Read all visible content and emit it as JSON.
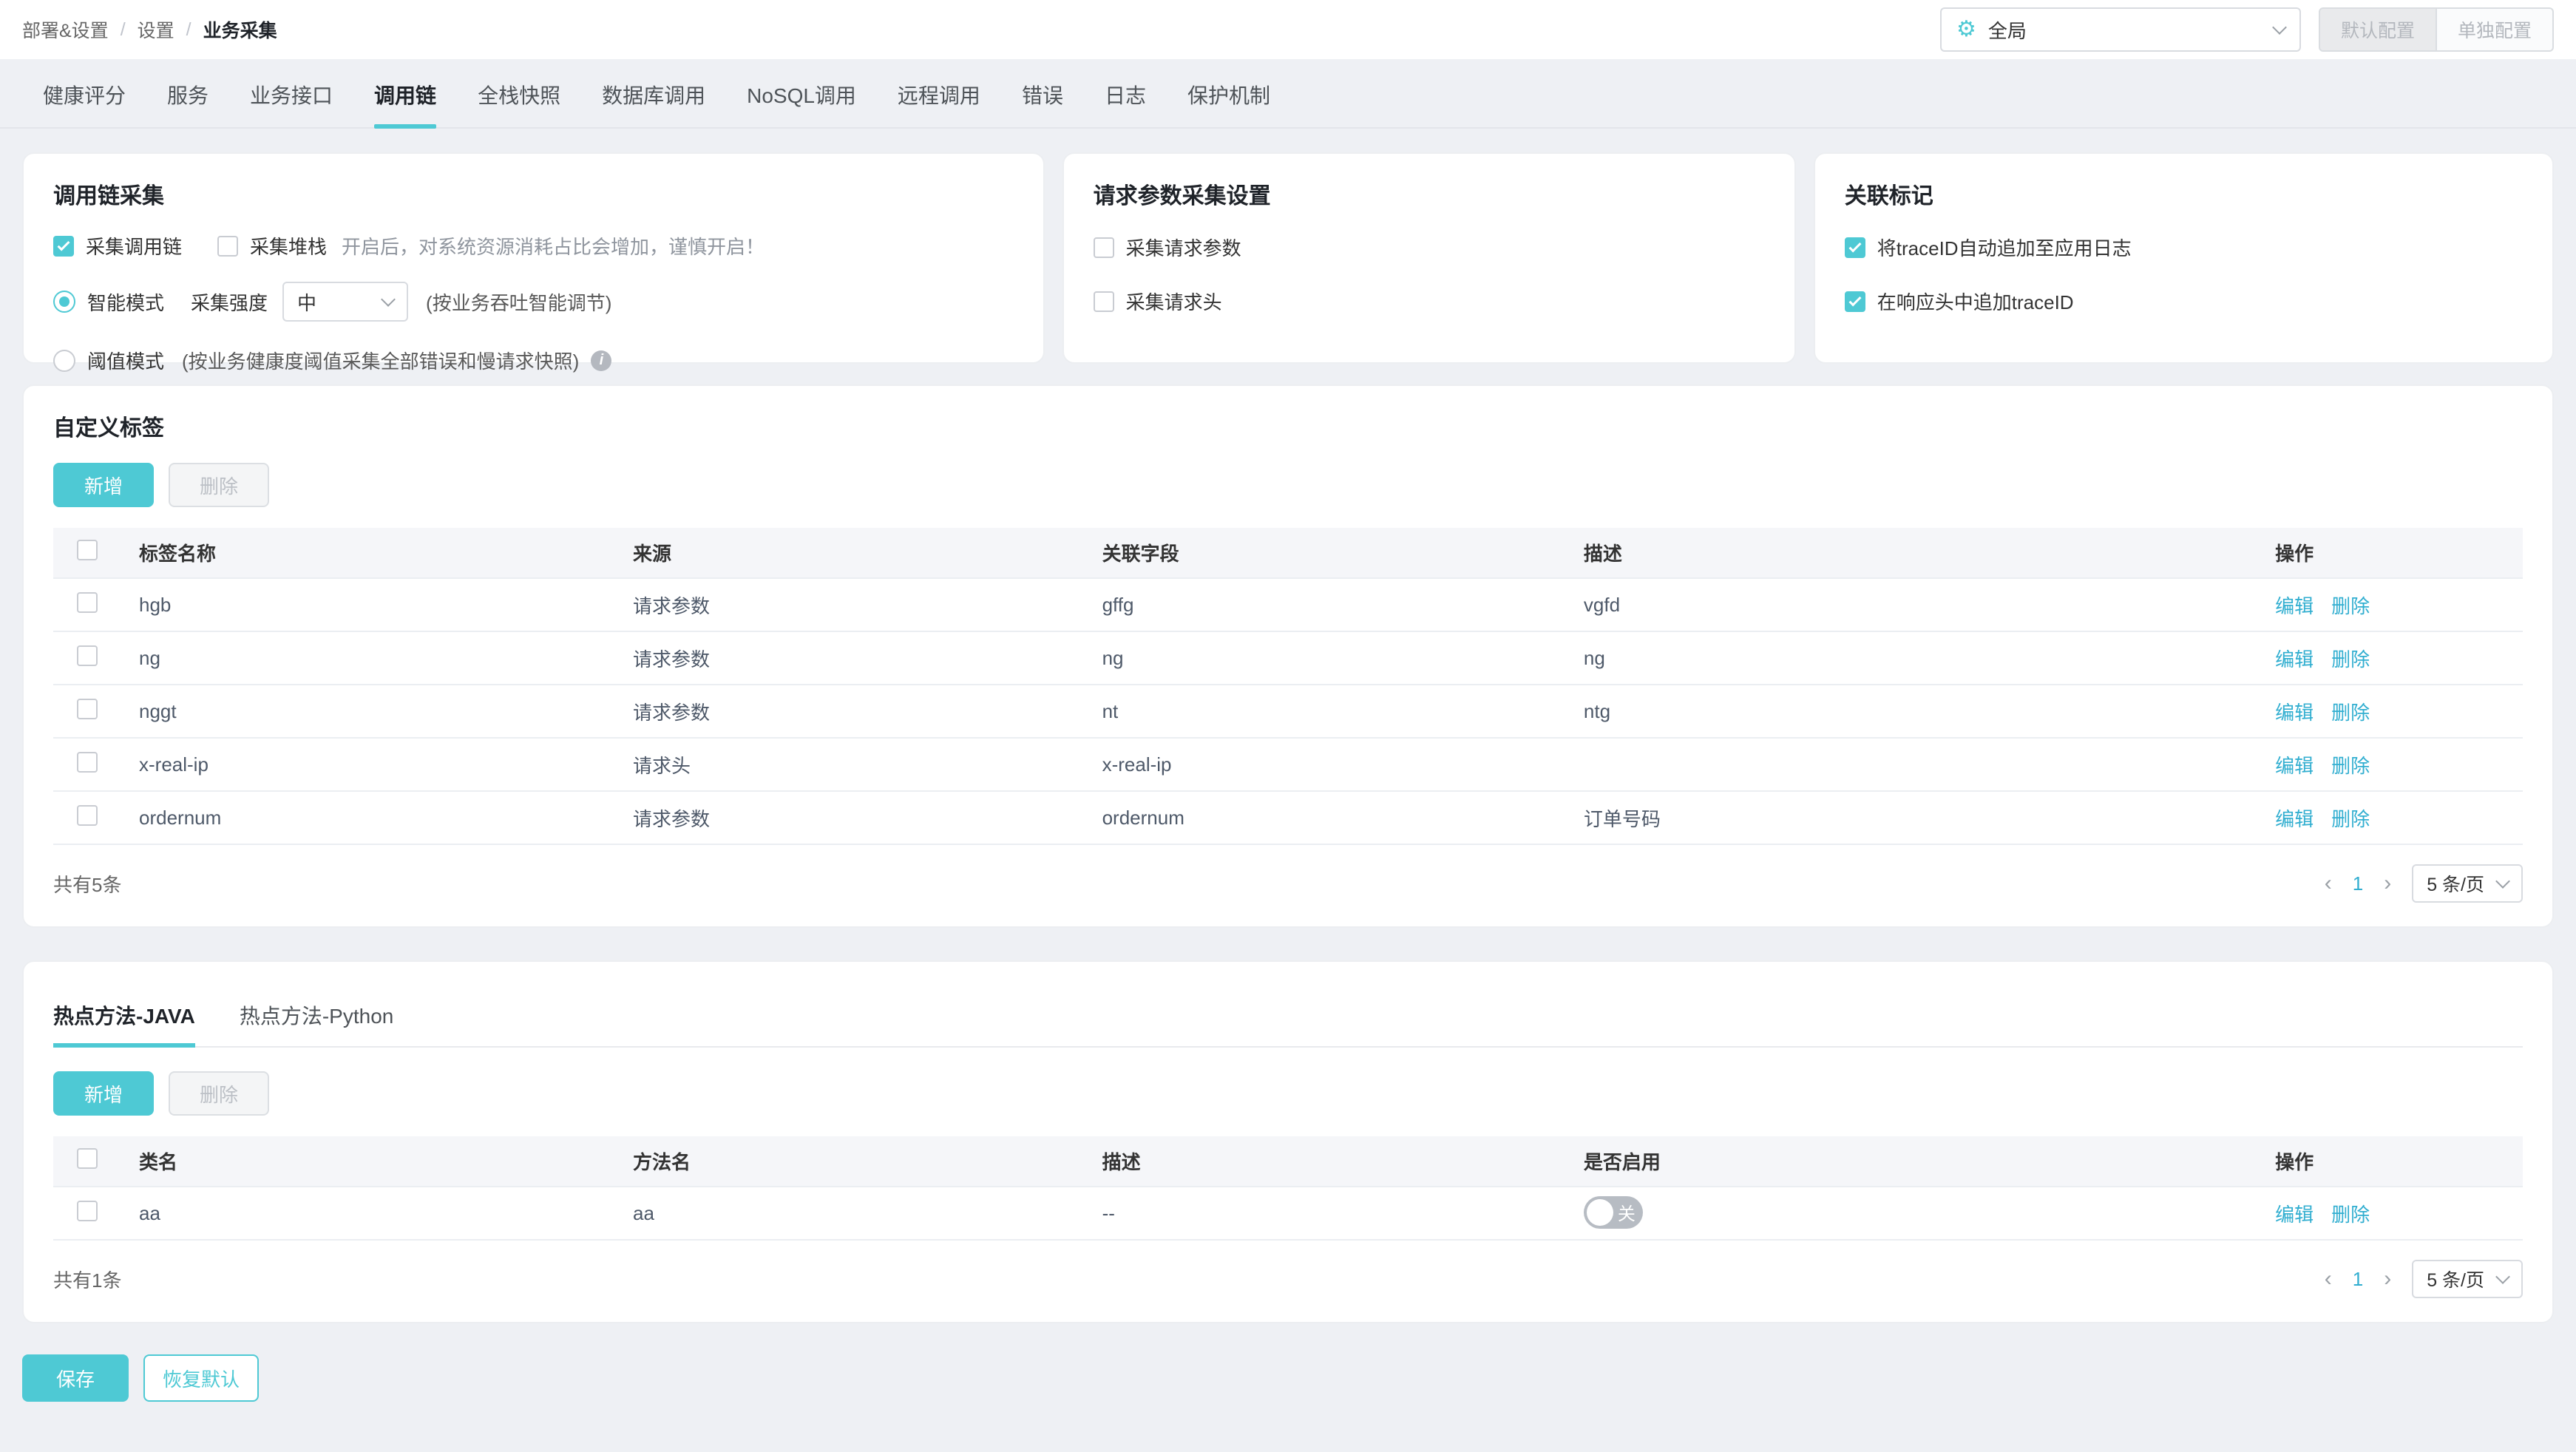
{
  "colors": {
    "accent": "#4ec9d4",
    "link": "#31aed0"
  },
  "icons": {
    "gear": "⚙",
    "info": "i",
    "prev": "‹",
    "next": "›"
  },
  "breadcrumb": {
    "items": [
      "部署&设置",
      "设置",
      "业务采集"
    ]
  },
  "header": {
    "scope_value": "全局",
    "default_config_btn": "默认配置",
    "separate_config_btn": "单独配置"
  },
  "tabs": [
    {
      "label": "健康评分",
      "active": false
    },
    {
      "label": "服务",
      "active": false
    },
    {
      "label": "业务接口",
      "active": false
    },
    {
      "label": "调用链",
      "active": true
    },
    {
      "label": "全栈快照",
      "active": false
    },
    {
      "label": "数据库调用",
      "active": false
    },
    {
      "label": "NoSQL调用",
      "active": false
    },
    {
      "label": "远程调用",
      "active": false
    },
    {
      "label": "错误",
      "active": false
    },
    {
      "label": "日志",
      "active": false
    },
    {
      "label": "保护机制",
      "active": false
    }
  ],
  "trace_card": {
    "title": "调用链采集",
    "cb_trace": {
      "label": "采集调用链",
      "checked": true
    },
    "cb_stack": {
      "label": "采集堆栈",
      "checked": false
    },
    "stack_hint": "开启后，对系统资源消耗占比会增加，谨慎开启！",
    "radio_smart": {
      "label": "智能模式",
      "selected": true
    },
    "intensity_label": "采集强度",
    "intensity_value": "中",
    "smart_hint": "(按业务吞吐智能调节)",
    "radio_threshold": {
      "label": "阈值模式",
      "selected": false
    },
    "threshold_hint": "(按业务健康度阈值采集全部错误和慢请求快照)"
  },
  "request_card": {
    "title": "请求参数采集设置",
    "cb_params": {
      "label": "采集请求参数",
      "checked": false
    },
    "cb_headers": {
      "label": "采集请求头",
      "checked": false
    }
  },
  "mark_card": {
    "title": "关联标记",
    "cb_log": {
      "label": "将traceID自动追加至应用日志",
      "checked": true
    },
    "cb_resp": {
      "label": "在响应头中追加traceID",
      "checked": true
    }
  },
  "custom_tags": {
    "title": "自定义标签",
    "add_btn": "新增",
    "delete_btn": "删除",
    "columns": {
      "name": "标签名称",
      "source": "来源",
      "field": "关联字段",
      "desc": "描述",
      "action": "操作"
    },
    "edit_label": "编辑",
    "remove_label": "删除",
    "rows": [
      {
        "name": "hgb",
        "source": "请求参数",
        "field": "gffg",
        "desc": "vgfd"
      },
      {
        "name": "ng",
        "source": "请求参数",
        "field": "ng",
        "desc": "ng"
      },
      {
        "name": "nggt",
        "source": "请求参数",
        "field": "nt",
        "desc": "ntg"
      },
      {
        "name": "x-real-ip",
        "source": "请求头",
        "field": "x-real-ip",
        "desc": ""
      },
      {
        "name": "ordernum",
        "source": "请求参数",
        "field": "ordernum",
        "desc": "订单号码"
      }
    ],
    "total": "共有5条",
    "page": "1",
    "page_size": "5 条/页"
  },
  "hot_methods": {
    "tab_java": "热点方法-JAVA",
    "tab_python": "热点方法-Python",
    "add_btn": "新增",
    "delete_btn": "删除",
    "columns": {
      "class": "类名",
      "method": "方法名",
      "desc": "描述",
      "enabled": "是否启用",
      "action": "操作"
    },
    "edit_label": "编辑",
    "remove_label": "删除",
    "rows": [
      {
        "class": "aa",
        "method": "aa",
        "desc": "--",
        "enabled": false,
        "toggle_label": "关"
      }
    ],
    "total": "共有1条",
    "page": "1",
    "page_size": "5 条/页"
  },
  "footer": {
    "save_btn": "保存",
    "reset_btn": "恢复默认"
  }
}
